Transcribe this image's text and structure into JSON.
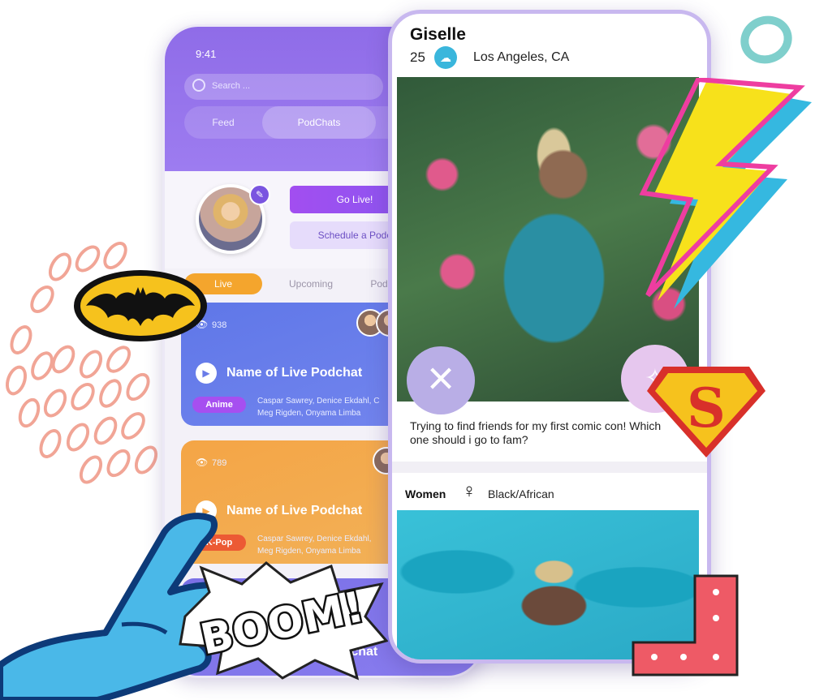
{
  "back_phone": {
    "time": "9:41",
    "search_placeholder": "Search ...",
    "tabs": [
      "Feed",
      "PodChats"
    ],
    "go_live": "Go Live!",
    "schedule": "Schedule a Podc",
    "subtabs": [
      "Live",
      "Upcoming",
      "Pod"
    ],
    "cards": [
      {
        "views": "938",
        "title": "Name of Live Podchat",
        "tag": "Anime",
        "tag_color": "#a64ff0",
        "hosts_line1": "Caspar Sawrey,  Denice Ekdahl,  C",
        "hosts_line2": "Meg Rigden,  Onyama Limba"
      },
      {
        "views": "789",
        "title": "Name of Live Podchat",
        "tag": "K-Pop",
        "tag_color": "#ec5a34",
        "hosts_line1": "Caspar Sawrey,  Denice Ekdahl,",
        "hosts_line2": "Meg Rigden,  Onyama Limba"
      },
      {
        "views": "",
        "title": "ne of Live Podchat",
        "tag": "",
        "tag_color": "#7a70e6",
        "hosts_line1": "",
        "hosts_line2": ""
      }
    ]
  },
  "front_phone": {
    "name": "Giselle",
    "age": "25",
    "location": "Los Angeles, CA",
    "caption": "Trying to find friends for my first comic con! Which one should i go to fam?",
    "gender": "Women",
    "ethnicity": "Black/African"
  },
  "decor": {
    "boom_text": "BOOM!",
    "superman_letter": "S"
  },
  "colors": {
    "primary": "#9b7cf0",
    "accent_orange": "#f4a52d",
    "card_blue": "#6a7ce8",
    "card_orange": "#f4a546",
    "frame": "#c8b8ef"
  }
}
